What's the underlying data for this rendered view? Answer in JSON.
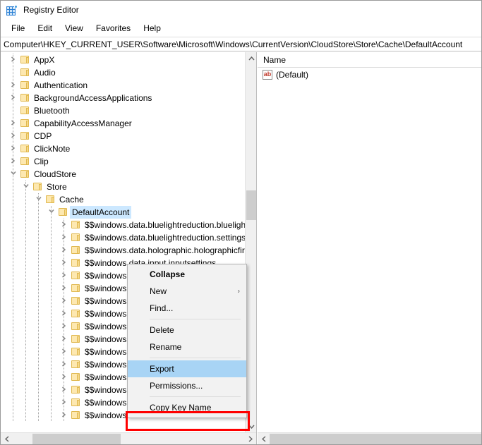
{
  "window": {
    "title": "Registry Editor",
    "icon": "registry-editor-icon"
  },
  "menubar": {
    "items": [
      {
        "label": "File"
      },
      {
        "label": "Edit"
      },
      {
        "label": "View"
      },
      {
        "label": "Favorites"
      },
      {
        "label": "Help"
      }
    ]
  },
  "address": {
    "path": "Computer\\HKEY_CURRENT_USER\\Software\\Microsoft\\Windows\\CurrentVersion\\CloudStore\\Store\\Cache\\DefaultAccount"
  },
  "tree": {
    "nodes": [
      {
        "label": "AppX",
        "indent": 1,
        "state": "collapsed",
        "selected": false
      },
      {
        "label": "Audio",
        "indent": 1,
        "state": "leaf",
        "selected": false
      },
      {
        "label": "Authentication",
        "indent": 1,
        "state": "collapsed",
        "selected": false
      },
      {
        "label": "BackgroundAccessApplications",
        "indent": 1,
        "state": "collapsed",
        "selected": false
      },
      {
        "label": "Bluetooth",
        "indent": 1,
        "state": "leaf",
        "selected": false
      },
      {
        "label": "CapabilityAccessManager",
        "indent": 1,
        "state": "collapsed",
        "selected": false
      },
      {
        "label": "CDP",
        "indent": 1,
        "state": "collapsed",
        "selected": false
      },
      {
        "label": "ClickNote",
        "indent": 1,
        "state": "collapsed",
        "selected": false
      },
      {
        "label": "Clip",
        "indent": 1,
        "state": "collapsed",
        "selected": false
      },
      {
        "label": "CloudStore",
        "indent": 1,
        "state": "expanded",
        "selected": false
      },
      {
        "label": "Store",
        "indent": 2,
        "state": "expanded",
        "selected": false
      },
      {
        "label": "Cache",
        "indent": 3,
        "state": "expanded",
        "selected": false
      },
      {
        "label": "DefaultAccount",
        "indent": 4,
        "state": "expanded",
        "selected": true
      },
      {
        "label": "$$windows.data.bluelightreduction.bluelightreductionstate",
        "indent": 5,
        "state": "collapsed",
        "selected": false
      },
      {
        "label": "$$windows.data.bluelightreduction.settings",
        "indent": 5,
        "state": "collapsed",
        "selected": false
      },
      {
        "label": "$$windows.data.holographic.holographicfirstrun",
        "indent": 5,
        "state": "collapsed",
        "selected": false
      },
      {
        "label": "$$windows.data.input.inputsettings",
        "indent": 5,
        "state": "collapsed",
        "selected": false
      },
      {
        "label": "$$windows.data.migration.migrationinfo",
        "indent": 5,
        "state": "collapsed",
        "selected": false
      },
      {
        "label": "$$windows.data.notifications.quietmoment",
        "indent": 5,
        "state": "collapsed",
        "selected": false
      },
      {
        "label": "$$windows.data.pensettings.pensettings",
        "indent": 5,
        "state": "collapsed",
        "selected": false
      },
      {
        "label": "$$windows.data.pinningconfiguration",
        "indent": 5,
        "state": "collapsed",
        "selected": false
      },
      {
        "label": "$$windows.data.place.placeinfo",
        "indent": 5,
        "state": "collapsed",
        "selected": false
      },
      {
        "label": "$$windows.data.searchresultsettings",
        "indent": 5,
        "state": "collapsed",
        "selected": false
      },
      {
        "label": "$$windows.data.sharepicker.mrulist",
        "indent": 5,
        "state": "collapsed",
        "selected": false
      },
      {
        "label": "$$windows.data.signals.registrations",
        "indent": 5,
        "state": "collapsed",
        "selected": false
      },
      {
        "label": "$$windows.data.taskflow.shellactivities",
        "indent": 5,
        "state": "collapsed",
        "selected": false
      },
      {
        "label": "$$windows.data.unifiedtile.localstartglobalproperties",
        "indent": 5,
        "state": "collapsed",
        "selected": false
      },
      {
        "label": "$$windows.data.unifiedtile.localstarttilelayout",
        "indent": 5,
        "state": "collapsed",
        "selected": false
      },
      {
        "label": "$$windows.data.unifiedtile.localstartvolatileproperties",
        "indent": 5,
        "state": "collapsed",
        "selected": false
      }
    ]
  },
  "values": {
    "columns": [
      "Name"
    ],
    "rows": [
      {
        "name": "(Default)",
        "icon": "string-value-icon"
      }
    ]
  },
  "context_menu": {
    "items": [
      {
        "label": "Collapse",
        "type": "item",
        "bold": true,
        "highlighted": false,
        "submenu": false
      },
      {
        "label": "New",
        "type": "item",
        "bold": false,
        "highlighted": false,
        "submenu": true
      },
      {
        "label": "Find...",
        "type": "item",
        "bold": false,
        "highlighted": false,
        "submenu": false
      },
      {
        "type": "separator"
      },
      {
        "label": "Delete",
        "type": "item",
        "bold": false,
        "highlighted": false,
        "submenu": false
      },
      {
        "label": "Rename",
        "type": "item",
        "bold": false,
        "highlighted": false,
        "submenu": false
      },
      {
        "type": "separator"
      },
      {
        "label": "Export",
        "type": "item",
        "bold": false,
        "highlighted": true,
        "submenu": false
      },
      {
        "label": "Permissions...",
        "type": "item",
        "bold": false,
        "highlighted": false,
        "submenu": false
      },
      {
        "type": "separator"
      },
      {
        "label": "Copy Key Name",
        "type": "item",
        "bold": false,
        "highlighted": false,
        "submenu": false
      }
    ]
  },
  "annotation": {
    "target": "Export",
    "color": "#ff0000"
  },
  "colors": {
    "selection": "#cce8ff",
    "menu_highlight": "#a8d4f5",
    "annotation_red": "#ff0000",
    "folder": "#fde8b0",
    "window_bg": "#ffffff"
  }
}
